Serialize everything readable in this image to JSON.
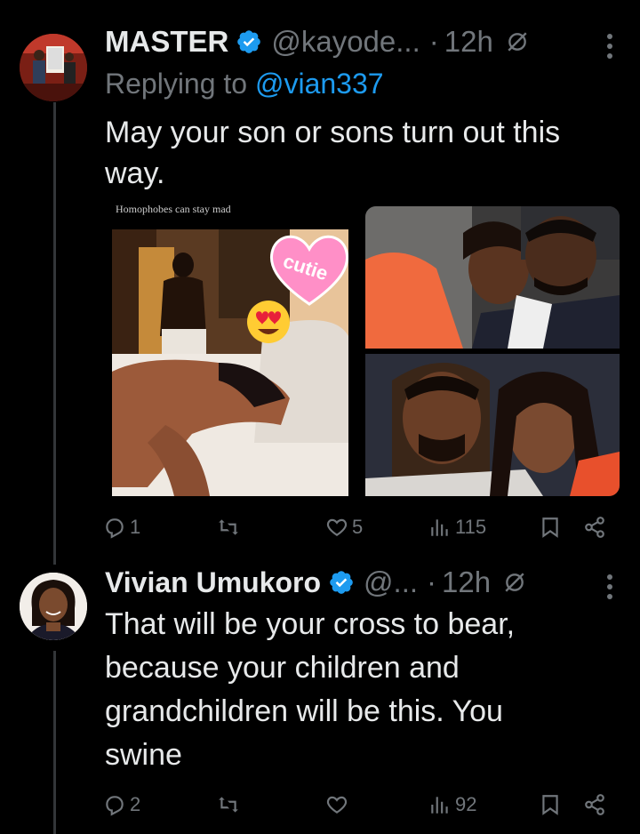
{
  "tweet1": {
    "author_name": "MASTER",
    "handle": "@kayode...",
    "dot": "·",
    "time": "12h",
    "replying_label": "Replying to ",
    "replying_mention": "@vian337",
    "text_line1": "May your son or sons turn out this",
    "text_line2": "way.",
    "media_caption": "Homophobes can stay mad",
    "sticker_text": "cutie",
    "stats": {
      "replies": "1",
      "reposts": "",
      "likes": "5",
      "views": "115"
    }
  },
  "tweet2": {
    "author_name": "Vivian Umukoro",
    "handle": "@...",
    "dot": "·",
    "time": "12h",
    "text_line1": "That will be your cross to bear,",
    "text_line2": "because your children and",
    "text_line3": "grandchildren will be this. You",
    "text_line4": "swine",
    "stats": {
      "replies": "2",
      "reposts": "",
      "likes": "",
      "views": "92"
    }
  },
  "colors": {
    "background": "#000000",
    "text": "#e7e9ea",
    "muted": "#71767b",
    "accent": "#1d9bf0"
  },
  "icons": [
    "verified-badge-icon",
    "grok-icon",
    "more-icon",
    "reply-icon",
    "repost-icon",
    "like-icon",
    "views-icon",
    "bookmark-icon",
    "share-icon"
  ]
}
